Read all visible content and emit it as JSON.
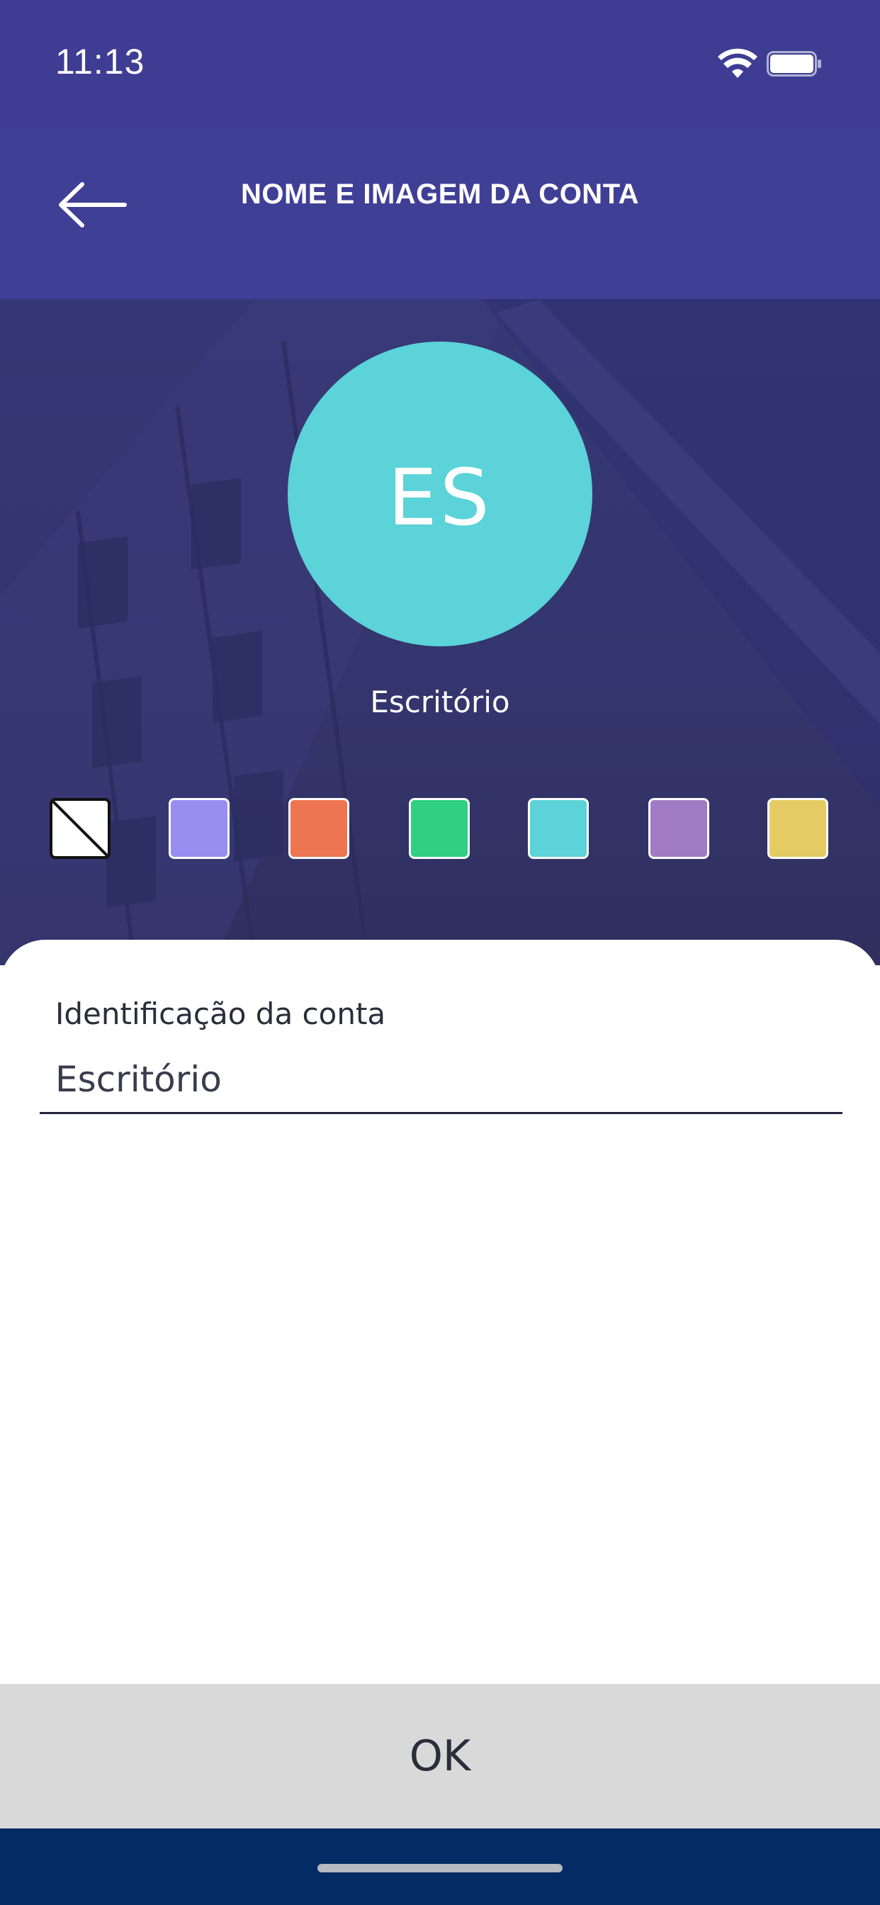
{
  "status_bar": {
    "time": "11:13"
  },
  "header": {
    "title": "NOME E IMAGEM DA CONTA"
  },
  "avatar": {
    "initials": "ES",
    "color": "#5bd3d8"
  },
  "account": {
    "name": "Escritório"
  },
  "color_options": [
    {
      "name": "none",
      "color": "#ffffff",
      "selected": true
    },
    {
      "name": "lavender",
      "color": "#968ef1",
      "selected": false
    },
    {
      "name": "coral",
      "color": "#ed7551",
      "selected": false
    },
    {
      "name": "green",
      "color": "#2fd082",
      "selected": false
    },
    {
      "name": "cyan",
      "color": "#5bd3d8",
      "selected": false
    },
    {
      "name": "purple",
      "color": "#a07bc4",
      "selected": false
    },
    {
      "name": "yellow",
      "color": "#e4cb63",
      "selected": false
    }
  ],
  "form": {
    "label": "Identificação da conta",
    "value": "Escritório"
  },
  "footer": {
    "ok_label": "OK"
  },
  "icons": {
    "back": "arrow-left-icon",
    "wifi": "wifi-icon",
    "battery": "battery-icon"
  }
}
